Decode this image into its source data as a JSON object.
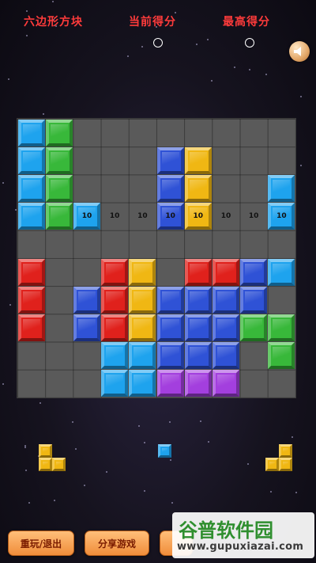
{
  "header": {
    "game_title": "六边形方块",
    "current_score_label": "当前得分",
    "best_score_label": "最高得分",
    "current_score": "0",
    "best_score": "0"
  },
  "board": {
    "size": 10,
    "hint_text": "10",
    "blocks": [
      {
        "r": 0,
        "c": 0,
        "color": "cyan"
      },
      {
        "r": 0,
        "c": 1,
        "color": "green"
      },
      {
        "r": 1,
        "c": 0,
        "color": "cyan"
      },
      {
        "r": 1,
        "c": 1,
        "color": "green"
      },
      {
        "r": 1,
        "c": 5,
        "color": "blue"
      },
      {
        "r": 1,
        "c": 6,
        "color": "yellow"
      },
      {
        "r": 2,
        "c": 0,
        "color": "cyan"
      },
      {
        "r": 2,
        "c": 1,
        "color": "green"
      },
      {
        "r": 2,
        "c": 5,
        "color": "blue"
      },
      {
        "r": 2,
        "c": 6,
        "color": "yellow"
      },
      {
        "r": 2,
        "c": 9,
        "color": "cyan"
      },
      {
        "r": 3,
        "c": 0,
        "color": "cyan"
      },
      {
        "r": 3,
        "c": 1,
        "color": "green"
      },
      {
        "r": 3,
        "c": 2,
        "color": "cyan"
      },
      {
        "r": 3,
        "c": 5,
        "color": "blue"
      },
      {
        "r": 3,
        "c": 6,
        "color": "yellow"
      },
      {
        "r": 3,
        "c": 9,
        "color": "cyan"
      },
      {
        "r": 5,
        "c": 0,
        "color": "red"
      },
      {
        "r": 5,
        "c": 3,
        "color": "red"
      },
      {
        "r": 5,
        "c": 4,
        "color": "yellow"
      },
      {
        "r": 5,
        "c": 6,
        "color": "red"
      },
      {
        "r": 5,
        "c": 7,
        "color": "red"
      },
      {
        "r": 5,
        "c": 8,
        "color": "blue"
      },
      {
        "r": 5,
        "c": 9,
        "color": "cyan"
      },
      {
        "r": 6,
        "c": 0,
        "color": "red"
      },
      {
        "r": 6,
        "c": 2,
        "color": "blue"
      },
      {
        "r": 6,
        "c": 3,
        "color": "red"
      },
      {
        "r": 6,
        "c": 4,
        "color": "yellow"
      },
      {
        "r": 6,
        "c": 5,
        "color": "blue"
      },
      {
        "r": 6,
        "c": 6,
        "color": "blue"
      },
      {
        "r": 6,
        "c": 7,
        "color": "blue"
      },
      {
        "r": 6,
        "c": 8,
        "color": "blue"
      },
      {
        "r": 7,
        "c": 0,
        "color": "red"
      },
      {
        "r": 7,
        "c": 2,
        "color": "blue"
      },
      {
        "r": 7,
        "c": 3,
        "color": "red"
      },
      {
        "r": 7,
        "c": 4,
        "color": "yellow"
      },
      {
        "r": 7,
        "c": 5,
        "color": "blue"
      },
      {
        "r": 7,
        "c": 6,
        "color": "blue"
      },
      {
        "r": 7,
        "c": 7,
        "color": "blue"
      },
      {
        "r": 7,
        "c": 8,
        "color": "green"
      },
      {
        "r": 7,
        "c": 9,
        "color": "green"
      },
      {
        "r": 8,
        "c": 3,
        "color": "cyan"
      },
      {
        "r": 8,
        "c": 4,
        "color": "cyan"
      },
      {
        "r": 8,
        "c": 5,
        "color": "blue"
      },
      {
        "r": 8,
        "c": 6,
        "color": "blue"
      },
      {
        "r": 8,
        "c": 7,
        "color": "blue"
      },
      {
        "r": 8,
        "c": 9,
        "color": "green"
      },
      {
        "r": 9,
        "c": 3,
        "color": "cyan"
      },
      {
        "r": 9,
        "c": 4,
        "color": "cyan"
      },
      {
        "r": 9,
        "c": 5,
        "color": "purple"
      },
      {
        "r": 9,
        "c": 6,
        "color": "purple"
      },
      {
        "r": 9,
        "c": 7,
        "color": "purple"
      }
    ],
    "hint_columns": [
      2,
      3,
      4,
      5,
      6,
      7,
      8,
      9
    ]
  },
  "pieces": [
    {
      "color": "yellow",
      "cells": [
        [
          0,
          0
        ],
        [
          1,
          0
        ],
        [
          1,
          1
        ]
      ]
    },
    {
      "color": "cyan",
      "cells": [
        [
          0,
          0
        ]
      ]
    },
    {
      "color": "yellow",
      "cells": [
        [
          0,
          1
        ],
        [
          1,
          0
        ],
        [
          1,
          1
        ]
      ]
    }
  ],
  "buttons": {
    "restart_exit": "重玩/退出",
    "share_game": "分享游戏"
  },
  "watermark": {
    "title": "谷普软件园",
    "url": "www.gupuxiazai.com"
  },
  "colors": {
    "cyan": "#1ea3ee",
    "green": "#38b83a",
    "blue": "#2f52d6",
    "yellow": "#f0b713",
    "red": "#e0211c",
    "purple": "#a33fde",
    "header_text": "#ff3b3b",
    "button": "#f5a25a"
  }
}
